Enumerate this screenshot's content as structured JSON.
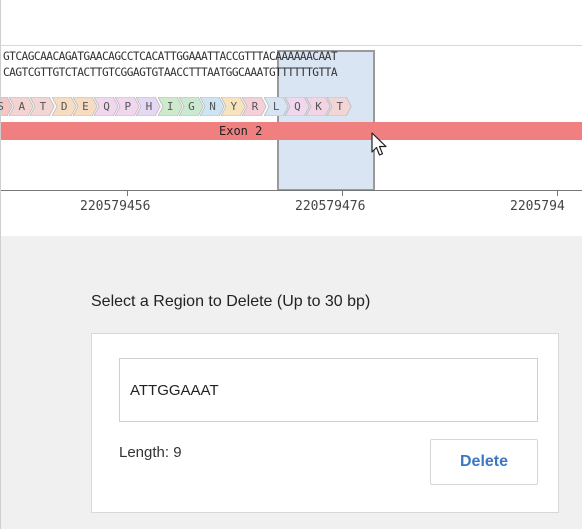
{
  "sequence": {
    "top_strand_before": "GTCAGCAACAGATGAACAGCCTCAC",
    "top_strand_selected": "ATTGGAAAT",
    "top_strand_after": "TACCGTTTACAAAAAACAAT",
    "bottom_strand_before": "CAGTCGTTGTCTACTTGTCGGAGTG",
    "bottom_strand_selected": "TAACCTTTA",
    "bottom_strand_after": "ATGGCAAATGTTTTTTGTTA"
  },
  "amino_acids": [
    {
      "letter": "S",
      "color": "#f4c6c6"
    },
    {
      "letter": "A",
      "color": "#f4d3d3"
    },
    {
      "letter": "T",
      "color": "#f2d6d6"
    },
    {
      "letter": "D",
      "color": "#f7dcc4"
    },
    {
      "letter": "E",
      "color": "#f7dcc4"
    },
    {
      "letter": "Q",
      "color": "#f1d7ee"
    },
    {
      "letter": "P",
      "color": "#f1d7ee"
    },
    {
      "letter": "H",
      "color": "#e4d8f2"
    },
    {
      "letter": "I",
      "color": "#cdeacc"
    },
    {
      "letter": "G",
      "color": "#c9ead1"
    },
    {
      "letter": "N",
      "color": "#cfe4f3"
    },
    {
      "letter": "Y",
      "color": "#f7e3bd"
    },
    {
      "letter": "R",
      "color": "#f4d0d8"
    },
    {
      "letter": "L",
      "color": "#d6e4f4"
    },
    {
      "letter": "Q",
      "color": "#f1d7ee"
    },
    {
      "letter": "K",
      "color": "#f2d4e4"
    },
    {
      "letter": "T",
      "color": "#f2d6d6"
    }
  ],
  "exon": {
    "label": "Exon 2",
    "color": "#f08080"
  },
  "axis": {
    "ticks": [
      "220579456",
      "220579476",
      "2205794"
    ]
  },
  "panel": {
    "heading": "Select a Region to Delete (Up to 30 bp)",
    "input_value": "ATTGGAAAT",
    "length_label": "Length: 9",
    "delete_label": "Delete"
  },
  "colors": {
    "accent": "#3b78c2",
    "selection": "#adc6e6"
  }
}
